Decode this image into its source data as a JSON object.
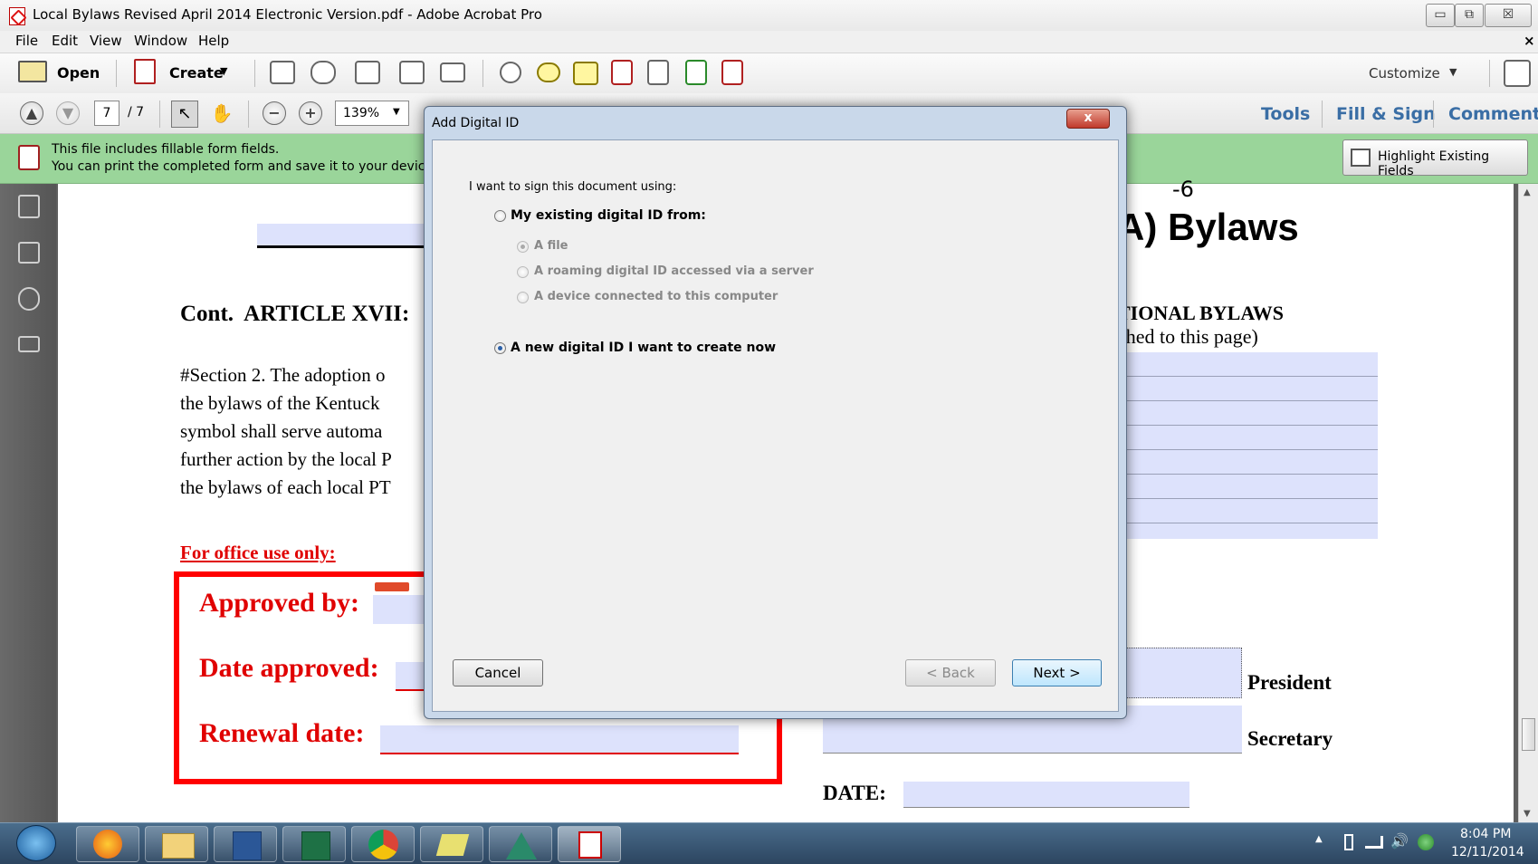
{
  "window": {
    "title": "Local Bylaws Revised April 2014 Electronic Version.pdf - Adobe Acrobat Pro",
    "minimize": "▭",
    "restore": "⧉",
    "close": "☒"
  },
  "menu": [
    "File",
    "Edit",
    "View",
    "Window",
    "Help"
  ],
  "menu_close": "×",
  "toolbar": {
    "open": "Open",
    "create": "Create",
    "customize": "Customize"
  },
  "nav": {
    "page_current": "7",
    "page_total": "/ 7",
    "zoom": "139%",
    "tools": "Tools",
    "fill_sign": "Fill & Sign",
    "comment": "Comment"
  },
  "formbar": {
    "line1": "This file includes fillable form fields.",
    "line2": "You can print the completed form and save it to your device or",
    "highlight": "Highlight Existing Fields"
  },
  "document": {
    "title_partial": "A) Bylaws",
    "page_number_partial": "-6",
    "article": "Cont.  ARTICLE XVII:",
    "article_right": "TIONAL BYLAWS",
    "article_right_sub": "ched to this page)",
    "section_lines": [
      "#Section 2. The adoption o",
      "the bylaws of the Kentuck",
      "symbol shall serve automa",
      "further action by the local P",
      "the bylaws of each local PT"
    ],
    "office_only": "For office use only:",
    "approved_by": "Approved by:",
    "date_approved": "Date approved:",
    "renewal_date": "Renewal date:",
    "president": "President",
    "secretary": "Secretary",
    "date_label": "DATE:"
  },
  "dialog": {
    "title": "Add Digital ID",
    "close": "x",
    "prompt": "I want to sign this document using:",
    "option_existing": "My existing digital ID from:",
    "sub_file": "A file",
    "sub_roaming": "A roaming digital ID accessed via a server",
    "sub_device": "A device connected to this computer",
    "option_new": "A new digital ID I want to create now",
    "cancel": "Cancel",
    "back": "< Back",
    "next": "Next >"
  },
  "taskbar": {
    "time": "8:04 PM",
    "date": "12/11/2014"
  }
}
